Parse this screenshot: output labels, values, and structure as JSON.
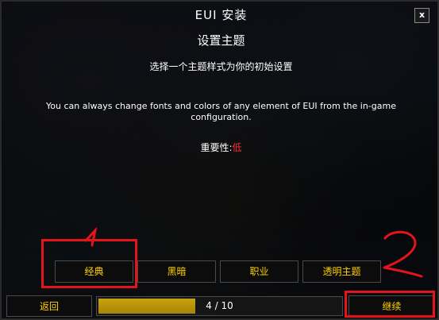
{
  "window": {
    "title": "EUI 安装",
    "close_label": "x"
  },
  "content": {
    "subtitle": "设置主题",
    "instruction": "选择一个主题样式为你的初始设置",
    "note": "You can always change fonts and colors of any element of EUI from the in-game configuration.",
    "importance_label": "重要性:",
    "importance_value": "低"
  },
  "theme_options": [
    {
      "label": "经典"
    },
    {
      "label": "黑暗"
    },
    {
      "label": "职业"
    },
    {
      "label": "透明主题"
    }
  ],
  "footer": {
    "back_label": "返回",
    "progress_text": "4 / 10",
    "progress_fraction": 0.4,
    "continue_label": "继续"
  },
  "colors": {
    "button_text": "#ffd100",
    "progress_fill": "#c9a20f",
    "importance_low": "#ff2d2d",
    "annotation": "#e3141a"
  }
}
